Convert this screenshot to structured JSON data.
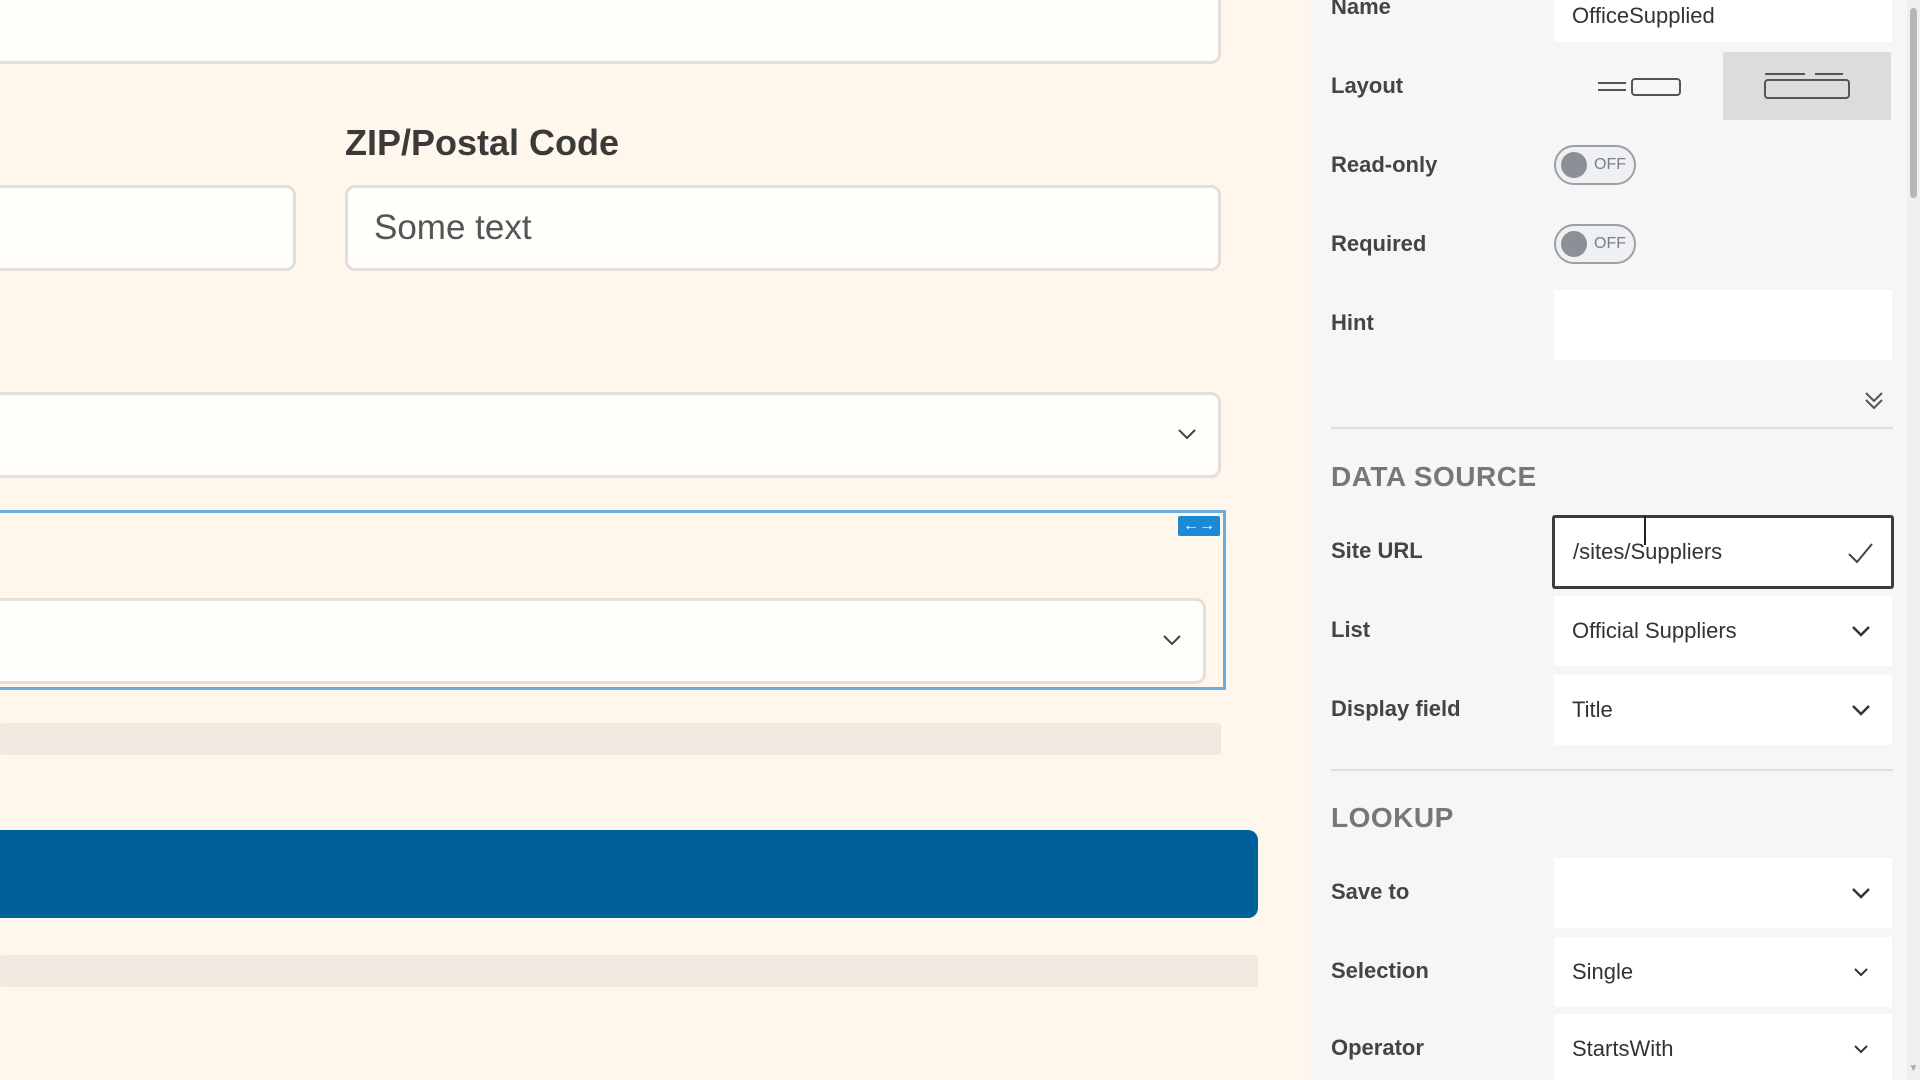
{
  "canvas": {
    "zip_label": "ZIP/Postal Code",
    "zip_value": "Some text",
    "resize_handle": "←→"
  },
  "panel": {
    "name": {
      "label": "Name",
      "value": "OfficeSupplied"
    },
    "layout": {
      "label": "Layout"
    },
    "readonly": {
      "label": "Read-only",
      "state": "OFF"
    },
    "required": {
      "label": "Required",
      "state": "OFF"
    },
    "hint": {
      "label": "Hint",
      "value": ""
    },
    "data_source": {
      "heading": "DATA SOURCE",
      "site_url": {
        "label": "Site URL",
        "value": "/sites/Suppliers"
      },
      "list": {
        "label": "List",
        "value": "Official Suppliers"
      },
      "display_field": {
        "label": "Display field",
        "value": "Title"
      }
    },
    "lookup": {
      "heading": "LOOKUP",
      "save_to": {
        "label": "Save to",
        "value": ""
      },
      "selection": {
        "label": "Selection",
        "value": "Single"
      },
      "operator": {
        "label": "Operator",
        "value": "StartsWith"
      }
    }
  }
}
